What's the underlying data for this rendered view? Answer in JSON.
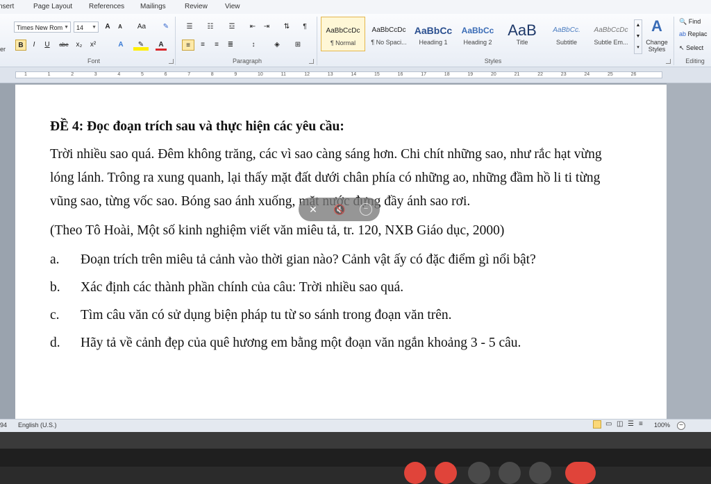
{
  "ribbon_tabs": [
    "nsert",
    "Page Layout",
    "References",
    "Mailings",
    "Review",
    "View"
  ],
  "font_group": {
    "font_name": "Times New Rom",
    "font_size": "14",
    "grow": "A",
    "shrink": "A",
    "case": "Aa",
    "bold": "B",
    "italic": "I",
    "underline": "U",
    "strike": "abe",
    "subscript": "x₂",
    "superscript": "x²",
    "label": "Font"
  },
  "paragraph_group": {
    "label": "Paragraph",
    "pilcrow": "¶"
  },
  "styles_group": {
    "label": "Styles",
    "items": [
      {
        "preview": "AaBbCcDc",
        "name": "¶ Normal"
      },
      {
        "preview": "AaBbCcDc",
        "name": "¶ No Spaci..."
      },
      {
        "preview": "AaBbCc",
        "name": "Heading 1"
      },
      {
        "preview": "AaBbCc",
        "name": "Heading 2"
      },
      {
        "preview": "AaB",
        "name": "Title"
      },
      {
        "preview": "AaBbCc.",
        "name": "Subtitle"
      },
      {
        "preview": "AaBbCcDc",
        "name": "Subtle Em..."
      }
    ],
    "change_styles": "Change Styles"
  },
  "editing_group": {
    "label": "Editing",
    "find": "Find",
    "replace": "Replac",
    "select": "Select"
  },
  "left_cut_label": "er",
  "ruler_numbers": [
    "1",
    "1",
    "2",
    "3",
    "4",
    "5",
    "6",
    "7",
    "8",
    "9",
    "10",
    "11",
    "12",
    "13",
    "14",
    "15",
    "16",
    "17",
    "18",
    "19",
    "20",
    "21",
    "22",
    "23",
    "24",
    "25",
    "26"
  ],
  "document": {
    "title": "ĐỀ 4: Đọc đoạn trích sau và thực hiện các yêu cầu:",
    "passage": "Trời nhiều sao quá. Đêm không trăng, các vì sao càng sáng hơn. Chi chít những sao, như rắc hạt vừng lóng lánh. Trông ra xung quanh, lại thấy mặt đất dưới chân phía có những ao, những đầm hồ li ti từng vũng sao, từng vốc sao. Bóng sao ánh xuống, mặt nước đựng đầy ánh sao rơi.",
    "source": "(Theo Tô Hoài, Một số kinh nghiệm viết văn miêu tả, tr. 120, NXB Giáo dục, 2000)",
    "questions": [
      {
        "label": "a.",
        "text": "Đoạn trích trên miêu tả cảnh vào thời gian nào? Cảnh vật ấy có đặc điểm gì nổi bật?"
      },
      {
        "label": "b.",
        "text": "Xác định các thành phần chính của câu: Trời nhiều sao quá."
      },
      {
        "label": "c.",
        "text": "Tìm câu văn có sử dụng biện pháp tu từ so sánh trong đoạn văn trên."
      },
      {
        "label": "d.",
        "text": "Hãy tả về cảnh đẹp của quê hương em bằng một đoạn văn ngắn khoảng 3 - 5 câu."
      }
    ]
  },
  "status_bar": {
    "page_fragment": "94",
    "language": "English (U.S.)",
    "zoom": "100%"
  },
  "colors": {
    "ribbon_bg": "#e8edf5",
    "active_style_border": "#e3b64c",
    "call_red": "#e0443a",
    "call_gray": "#4a4a4a"
  }
}
